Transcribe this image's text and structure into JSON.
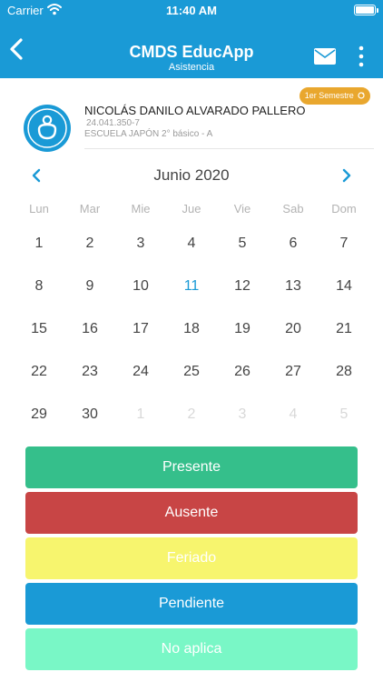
{
  "status_bar": {
    "carrier": "Carrier",
    "time": "11:40 AM",
    "battery_level": 1.0
  },
  "header": {
    "title": "CMDS EducApp",
    "subtitle": "Asistencia",
    "back_icon": "chevron-left-icon",
    "mail_icon": "mail-icon",
    "menu_icon": "more-vertical-icon"
  },
  "semester_badge": {
    "label": "1er Semestre"
  },
  "student": {
    "name": "NICOLÁS DANILO ALVARADO PALLERO",
    "id": "24.041.350-7",
    "school": "ESCUELA JAPÓN 2° básico - A"
  },
  "calendar": {
    "month": "Junio 2020",
    "weekdays": [
      "Lun",
      "Mar",
      "Mie",
      "Jue",
      "Vie",
      "Sab",
      "Dom"
    ],
    "selected_day": "11",
    "weeks": [
      [
        "1",
        "2",
        "3",
        "4",
        "5",
        "6",
        "7"
      ],
      [
        "8",
        "9",
        "10",
        "11",
        "12",
        "13",
        "14"
      ],
      [
        "15",
        "16",
        "17",
        "18",
        "19",
        "20",
        "21"
      ],
      [
        "22",
        "23",
        "24",
        "25",
        "26",
        "27",
        "28"
      ],
      [
        "29",
        "30",
        "1",
        "2",
        "3",
        "4",
        "5"
      ]
    ],
    "dim_cells": [
      [
        4,
        2
      ],
      [
        4,
        3
      ],
      [
        4,
        4
      ],
      [
        4,
        5
      ],
      [
        4,
        6
      ]
    ]
  },
  "legend": [
    {
      "label": "Presente",
      "color": "#35bf8b"
    },
    {
      "label": "Ausente",
      "color": "#c84545"
    },
    {
      "label": "Feriado",
      "color": "#f7f56e"
    },
    {
      "label": "Pendiente",
      "color": "#1a9ad6"
    },
    {
      "label": "No aplica",
      "color": "#79f7c6"
    }
  ]
}
